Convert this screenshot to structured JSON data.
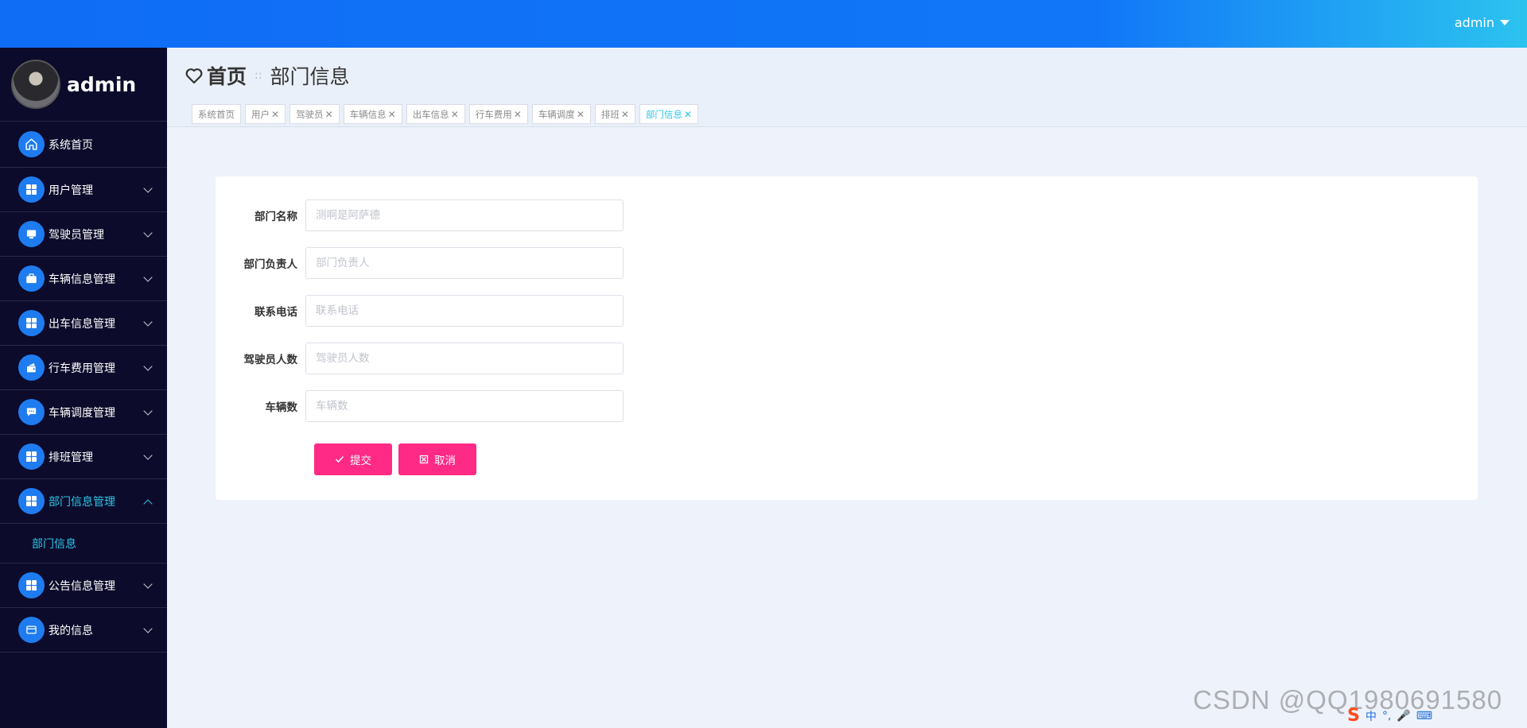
{
  "header": {
    "user_label": "admin"
  },
  "sidebar": {
    "profile_name": "admin",
    "items": [
      {
        "label": "系统首页",
        "icon": "home-icon"
      },
      {
        "label": "用户管理",
        "icon": "grid-icon"
      },
      {
        "label": "驾驶员管理",
        "icon": "monitor-icon"
      },
      {
        "label": "车辆信息管理",
        "icon": "briefcase-icon"
      },
      {
        "label": "出车信息管理",
        "icon": "grid-icon"
      },
      {
        "label": "行车费用管理",
        "icon": "wallet-icon"
      },
      {
        "label": "车辆调度管理",
        "icon": "chat-icon"
      },
      {
        "label": "排班管理",
        "icon": "grid-icon"
      },
      {
        "label": "部门信息管理",
        "icon": "grid-icon"
      },
      {
        "label": "公告信息管理",
        "icon": "grid-icon"
      },
      {
        "label": "我的信息",
        "icon": "card-icon"
      }
    ],
    "submenu": {
      "label": "部门信息"
    }
  },
  "breadcrumb": {
    "home": "首页",
    "separator": "::",
    "current": "部门信息"
  },
  "tabs": [
    {
      "label": "系统首页",
      "closable": false
    },
    {
      "label": "用户",
      "closable": true
    },
    {
      "label": "驾驶员",
      "closable": true
    },
    {
      "label": "车辆信息",
      "closable": true
    },
    {
      "label": "出车信息",
      "closable": true
    },
    {
      "label": "行车费用",
      "closable": true
    },
    {
      "label": "车辆调度",
      "closable": true
    },
    {
      "label": "排班",
      "closable": true
    },
    {
      "label": "部门信息",
      "closable": true
    }
  ],
  "form": {
    "fields": [
      {
        "label": "部门名称",
        "placeholder": "测啊是阿萨德"
      },
      {
        "label": "部门负责人",
        "placeholder": "部门负责人"
      },
      {
        "label": "联系电话",
        "placeholder": "联系电话"
      },
      {
        "label": "驾驶员人数",
        "placeholder": "驾驶员人数"
      },
      {
        "label": "车辆数",
        "placeholder": "车辆数"
      }
    ],
    "submit_label": "提交",
    "cancel_label": "取消"
  },
  "watermark": "CSDN @QQ1980691580",
  "tray": {
    "ime_lang": "中",
    "punct": "°,"
  },
  "colors": {
    "topbar_start": "#0f6cf5",
    "topbar_end": "#2cc3ef",
    "sidebar_bg": "#0c0b2b",
    "icon_circle": "#1e7cf0",
    "active_text": "#2bc6e7",
    "button_pink": "#ff2a86",
    "page_bg": "#eef2fa"
  }
}
